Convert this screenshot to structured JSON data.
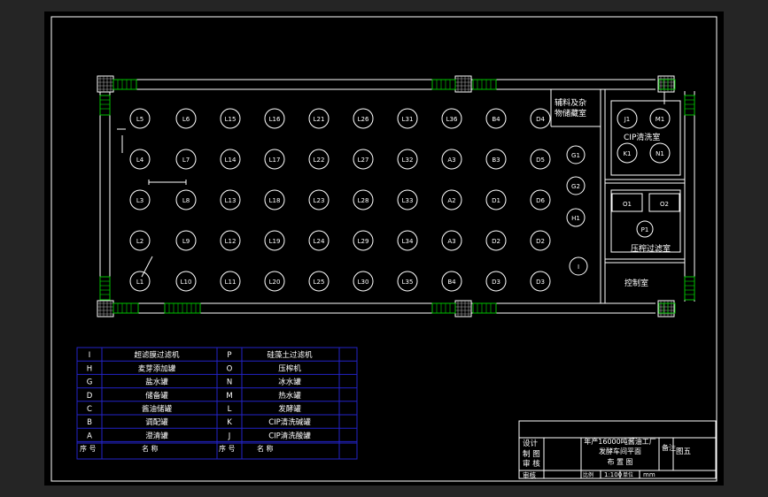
{
  "layout": {
    "equipment_rows": [
      [
        "L5",
        "L6",
        "L15",
        "L16",
        "L21",
        "L26",
        "L31",
        "L36",
        "B4",
        "D4"
      ],
      [
        "L4",
        "L7",
        "L14",
        "L17",
        "L22",
        "L27",
        "L32",
        "A3",
        "B3",
        "D5"
      ],
      [
        "L3",
        "L8",
        "L13",
        "L18",
        "L23",
        "L28",
        "L33",
        "A2",
        "D1",
        "D6"
      ],
      [
        "L2",
        "L9",
        "L12",
        "L19",
        "L24",
        "L29",
        "L34",
        "A3",
        "D2",
        "D2"
      ],
      [
        "L1",
        "L10",
        "L11",
        "L20",
        "L25",
        "L30",
        "L35",
        "B4",
        "D3",
        "D3"
      ]
    ],
    "side_equipment": [
      "G1",
      "G2",
      "H1",
      "I"
    ],
    "rooms": {
      "storage": [
        "辅料及杂",
        "物储藏室"
      ],
      "cip": "CIP清洗室",
      "cip_units": [
        "J1",
        "M1",
        "K1",
        "N1"
      ],
      "filter": "压榨过滤室",
      "filter_units": [
        "O1",
        "O2",
        "P1"
      ],
      "control": "控制室"
    }
  },
  "legend": {
    "rows": [
      {
        "code_left": "I",
        "name_left": "超滤膜过滤机",
        "code_right": "P",
        "name_right": "硅藻土过滤机"
      },
      {
        "code_left": "H",
        "name_left": "麦芽添加罐",
        "code_right": "O",
        "name_right": "压榨机"
      },
      {
        "code_left": "G",
        "name_left": "盐水罐",
        "code_right": "N",
        "name_right": "冰水罐"
      },
      {
        "code_left": "D",
        "name_left": "储备罐",
        "code_right": "M",
        "name_right": "热水罐"
      },
      {
        "code_left": "C",
        "name_left": "酱油储罐",
        "code_right": "L",
        "name_right": "发酵罐"
      },
      {
        "code_left": "B",
        "name_left": "调配罐",
        "code_right": "K",
        "name_right": "CIP清洗碱罐"
      },
      {
        "code_left": "A",
        "name_left": "澄清罐",
        "code_right": "J",
        "name_right": "CIP清洗酸罐"
      }
    ],
    "footer": {
      "seq": "序 号",
      "name": "名 称"
    }
  },
  "title_block": {
    "labels": [
      "设计",
      "制 图",
      "审 核"
    ],
    "title_lines": [
      "年产16000吨酱油工厂",
      "发酵车间平面",
      "布 置 图"
    ],
    "remark": "备注",
    "figure": "图五",
    "bottom_label": "审核",
    "ratio_label": "比例",
    "scale": "1:100",
    "unit_label": "单位",
    "unit": "mm"
  },
  "colors": {
    "background": "#000000",
    "walls": "#ffffff",
    "windows": "#00c000",
    "tables": "#2323c8",
    "frame": "#252525"
  }
}
